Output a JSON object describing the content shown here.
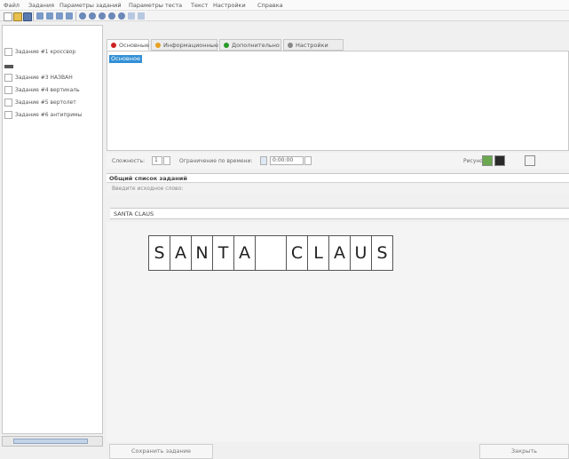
{
  "menu": [
    "Файл",
    "Задания",
    "Параметры заданий",
    "Параметры теста",
    "Текст",
    "Настройки",
    "Справка"
  ],
  "tasks": [
    "Задание #1 кроссвор",
    "Задание #3 НАЗВАН",
    "Задание #4 вертикаль",
    "Задание #5 вертолет",
    "Задание #6 антипримы"
  ],
  "tabs": [
    "Основные",
    "Информационные",
    "Дополнительно",
    "Настройки"
  ],
  "selected_item": "Основное",
  "controls": {
    "label1": "Сложность:",
    "value1": "1",
    "label2": "Ограничение по времени:",
    "value2": "0:00:00",
    "label3": "Рисунок:"
  },
  "section": {
    "title": "Общий список заданий",
    "subtitle": "Введите исходное слово:"
  },
  "word_input": "SANTA CLAUS",
  "letters": [
    "S",
    "A",
    "N",
    "T",
    "A",
    "",
    "C",
    "L",
    "A",
    "U",
    "S"
  ],
  "buttons": {
    "left": "Сохранить задание",
    "right": "Закрыть"
  },
  "colors": {
    "tab1": "#cc2222",
    "tab2": "#e8a020",
    "tab3": "#2a9a2a",
    "tab4": "#888888",
    "selection": "#3390d6"
  }
}
